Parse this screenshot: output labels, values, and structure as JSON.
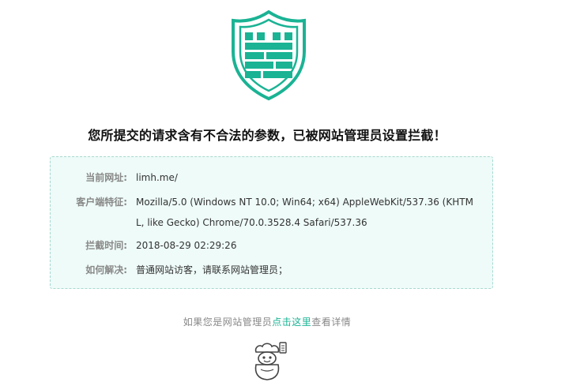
{
  "colors": {
    "accent": "#1ab394",
    "box_background": "#eefbf8",
    "label": "#888888"
  },
  "icons": {
    "shield": "shield-wall-icon",
    "logo": "mascot-logo-icon"
  },
  "headline": "您所提交的请求含有不合法的参数，已被网站管理员设置拦截！",
  "info": {
    "url_label": "当前网址:",
    "url_value": "limh.me/",
    "ua_label": "客户端特征:",
    "ua_value": "Mozilla/5.0 (Windows NT 10.0; Win64; x64) AppleWebKit/537.36 (KHTML, like Gecko) Chrome/70.0.3528.4 Safari/537.36",
    "time_label": "拦截时间:",
    "time_value": "2018-08-29 02:29:26",
    "solve_label": "如何解决:",
    "solve_value": "普通网站访客，请联系网站管理员；"
  },
  "admin": {
    "prefix": "如果您是网站管理员",
    "link": "点击这里",
    "suffix": "查看详情"
  }
}
